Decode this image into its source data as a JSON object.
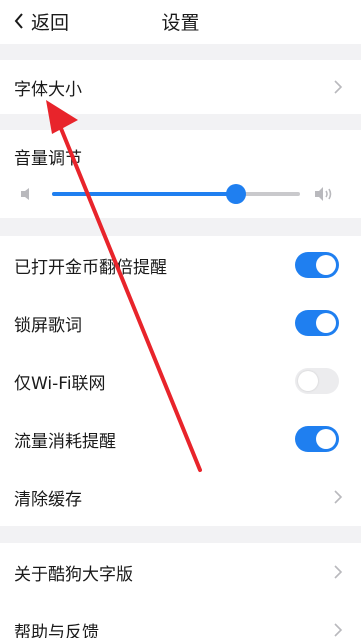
{
  "header": {
    "back_label": "返回",
    "title": "设置"
  },
  "font_size": {
    "label": "字体大小"
  },
  "volume": {
    "label": "音量调节",
    "level_percent": 74
  },
  "toggles": [
    {
      "label": "已打开金币翻倍提醒",
      "on": true
    },
    {
      "label": "锁屏歌词",
      "on": true
    },
    {
      "label": "仅Wi-Fi联网",
      "on": false
    },
    {
      "label": "流量消耗提醒",
      "on": true
    }
  ],
  "clear_cache": {
    "label": "清除缓存"
  },
  "about": {
    "label": "关于酷狗大字版"
  },
  "help": {
    "label": "帮助与反馈"
  },
  "colors": {
    "accent": "#1f7ff0",
    "annotation_arrow": "#e8242b"
  }
}
